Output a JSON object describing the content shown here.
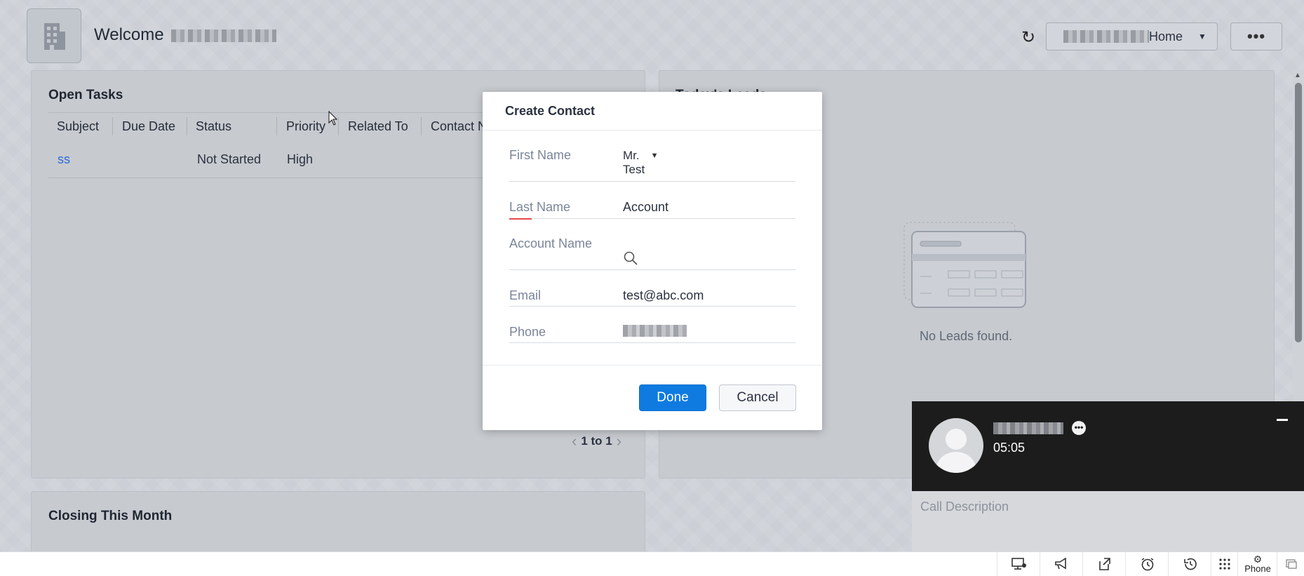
{
  "header": {
    "welcome": "Welcome",
    "home_selector": "Home",
    "more": "•••"
  },
  "open_tasks": {
    "title": "Open Tasks",
    "columns": [
      "Subject",
      "Due Date",
      "Status",
      "Priority",
      "Related To",
      "Contact N"
    ],
    "rows": [
      {
        "subject": "ss",
        "due_date": "",
        "status": "Not Started",
        "priority": "High"
      }
    ],
    "pagination": "1 to 1"
  },
  "todays_leads": {
    "title": "Today's Leads",
    "empty": "No Leads found."
  },
  "closing": {
    "title": "Closing This Month"
  },
  "modal": {
    "title": "Create Contact",
    "first_name_label": "First Name",
    "salutation": "Mr.",
    "first_name": "Test",
    "last_name_label": "Last Name",
    "last_name": "Account",
    "account_name_label": "Account Name",
    "email_label": "Email",
    "email": "test@abc.com",
    "phone_label": "Phone",
    "done": "Done",
    "cancel": "Cancel"
  },
  "call": {
    "timer": "05:05",
    "description_placeholder": "Call Description"
  },
  "bottom_bar": {
    "phone_label": "Phone",
    "icons": [
      "screen-share-icon",
      "megaphone-icon",
      "transfer-icon",
      "alarm-icon",
      "history-icon",
      "grid-icon",
      "settings-icon",
      "chat-icon"
    ]
  },
  "colors": {
    "primary": "#0f7be0",
    "link": "#2f6bd6",
    "required": "#e5484d",
    "call_bg": "#1c1c1c"
  }
}
